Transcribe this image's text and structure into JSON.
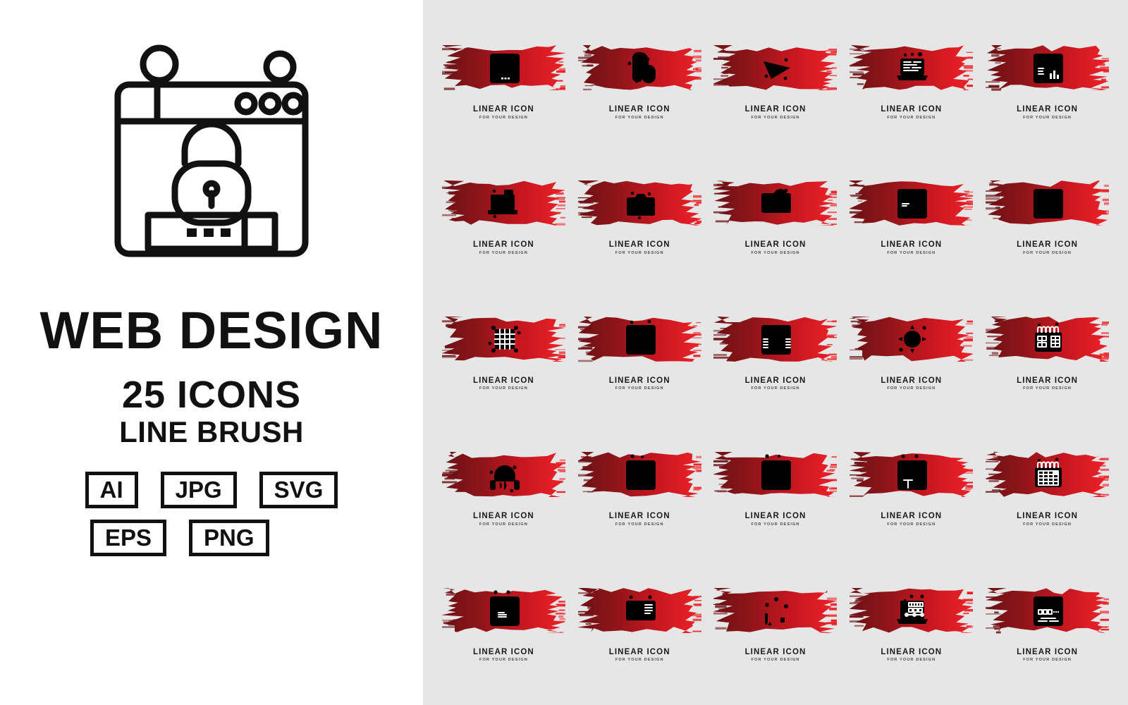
{
  "cover": {
    "hero_icon": "browser-password-lock-icon",
    "title": "WEB DESIGN",
    "count": "25 ICONS",
    "style": "LINE BRUSH",
    "formats_row1": [
      "AI",
      "JPG",
      "SVG"
    ],
    "formats_row2": [
      "EPS",
      "PNG"
    ],
    "background": "#ffffff",
    "text_color": "#111111"
  },
  "grid": {
    "background": "#e6e6e6",
    "columns": 5,
    "rows": 5,
    "brush_color_dark": "#7a1418",
    "brush_color_light": "#e8202a",
    "icon_stroke": "#ffffff",
    "caption_main": "LINEAR ICON",
    "caption_sub": "FOR YOUR DESIGN",
    "items": [
      {
        "icon": "browser-password-lock-icon",
        "label": "LINEAR ICON",
        "sublabel": "FOR YOUR DESIGN"
      },
      {
        "icon": "computer-mouse-icon",
        "label": "LINEAR ICON",
        "sublabel": "FOR YOUR DESIGN"
      },
      {
        "icon": "paper-plane-send-icon",
        "label": "LINEAR ICON",
        "sublabel": "FOR YOUR DESIGN"
      },
      {
        "icon": "laptop-code-icon",
        "label": "LINEAR ICON",
        "sublabel": "FOR YOUR DESIGN"
      },
      {
        "icon": "browser-analytics-chart-icon",
        "label": "LINEAR ICON",
        "sublabel": "FOR YOUR DESIGN"
      },
      {
        "icon": "responsive-devices-icon",
        "label": "LINEAR ICON",
        "sublabel": "FOR YOUR DESIGN"
      },
      {
        "icon": "photo-camera-icon",
        "label": "LINEAR ICON",
        "sublabel": "FOR YOUR DESIGN"
      },
      {
        "icon": "monitor-star-favorite-icon",
        "label": "LINEAR ICON",
        "sublabel": "FOR YOUR DESIGN"
      },
      {
        "icon": "browser-chat-user-icon",
        "label": "LINEAR ICON",
        "sublabel": "FOR YOUR DESIGN"
      },
      {
        "icon": "browser-image-edit-icon",
        "label": "LINEAR ICON",
        "sublabel": "FOR YOUR DESIGN"
      },
      {
        "icon": "grid-transform-tool-icon",
        "label": "LINEAR ICON",
        "sublabel": "FOR YOUR DESIGN"
      },
      {
        "icon": "browser-image-slider-icon",
        "label": "LINEAR ICON",
        "sublabel": "FOR YOUR DESIGN"
      },
      {
        "icon": "browser-pie-analytics-icon",
        "label": "LINEAR ICON",
        "sublabel": "FOR YOUR DESIGN"
      },
      {
        "icon": "move-target-tool-icon",
        "label": "LINEAR ICON",
        "sublabel": "FOR YOUR DESIGN"
      },
      {
        "icon": "calendar-notebook-icon",
        "label": "LINEAR ICON",
        "sublabel": "FOR YOUR DESIGN"
      },
      {
        "icon": "headphones-icon",
        "label": "LINEAR ICON",
        "sublabel": "FOR YOUR DESIGN"
      },
      {
        "icon": "browser-content-layout-icon",
        "label": "LINEAR ICON",
        "sublabel": "FOR YOUR DESIGN"
      },
      {
        "icon": "browser-globe-web-icon",
        "label": "LINEAR ICON",
        "sublabel": "FOR YOUR DESIGN"
      },
      {
        "icon": "browser-text-tool-icon",
        "label": "LINEAR ICON",
        "sublabel": "FOR YOUR DESIGN"
      },
      {
        "icon": "calendar-grid-icon",
        "label": "LINEAR ICON",
        "sublabel": "FOR YOUR DESIGN"
      },
      {
        "icon": "browser-document-download-icon",
        "label": "LINEAR ICON",
        "sublabel": "FOR YOUR DESIGN"
      },
      {
        "icon": "monitor-video-player-icon",
        "label": "LINEAR ICON",
        "sublabel": "FOR YOUR DESIGN"
      },
      {
        "icon": "drafting-compass-icon",
        "label": "LINEAR ICON",
        "sublabel": "FOR YOUR DESIGN"
      },
      {
        "icon": "laptop-design-tools-icon",
        "label": "LINEAR ICON",
        "sublabel": "FOR YOUR DESIGN"
      },
      {
        "icon": "browser-layout-blocks-icon",
        "label": "LINEAR ICON",
        "sublabel": "FOR YOUR DESIGN"
      }
    ]
  }
}
